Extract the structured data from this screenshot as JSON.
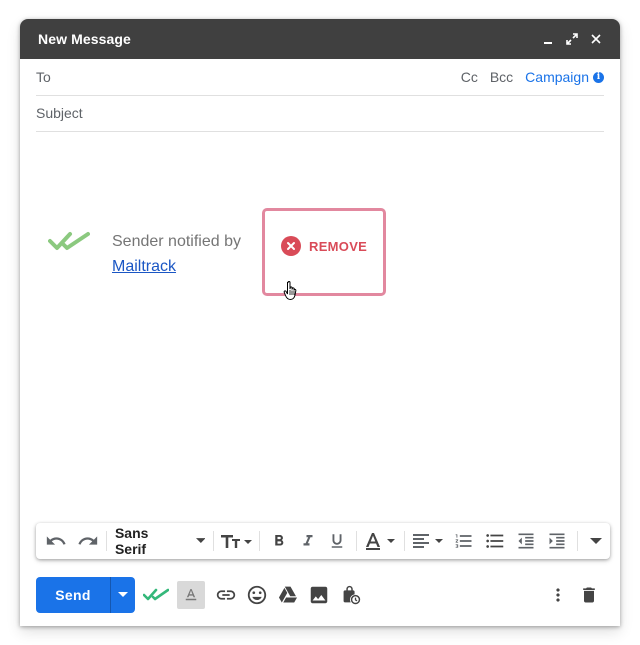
{
  "window": {
    "title": "New Message"
  },
  "recipients": {
    "to_label": "To",
    "cc_label": "Cc",
    "bcc_label": "Bcc",
    "campaign_label": "Campaign",
    "info_glyph": "i"
  },
  "subject": {
    "label": "Subject"
  },
  "signature": {
    "text": "Sender notified by",
    "link": "Mailtrack",
    "check_color": "#8bc97f"
  },
  "remove": {
    "label": "REMOVE",
    "color": "#d94b58",
    "highlight_color": "#e2889f"
  },
  "toolbar": {
    "font_name": "Sans Serif",
    "icons": [
      "undo-icon",
      "redo-icon",
      "font-select",
      "text-size-icon",
      "bold-icon",
      "italic-icon",
      "underline-icon",
      "text-color-icon",
      "align-icon",
      "numbered-list-icon",
      "bulleted-list-icon",
      "indent-less-icon",
      "indent-more-icon",
      "more-formatting-icon"
    ]
  },
  "bottom_bar": {
    "send_label": "Send",
    "accent": "#1a73e8",
    "icons": [
      "mailtrack-check-icon",
      "formatting-options-icon",
      "link-icon",
      "emoji-icon",
      "drive-icon",
      "photo-icon",
      "confidential-mode-icon",
      "more-options-icon",
      "trash-icon"
    ]
  }
}
